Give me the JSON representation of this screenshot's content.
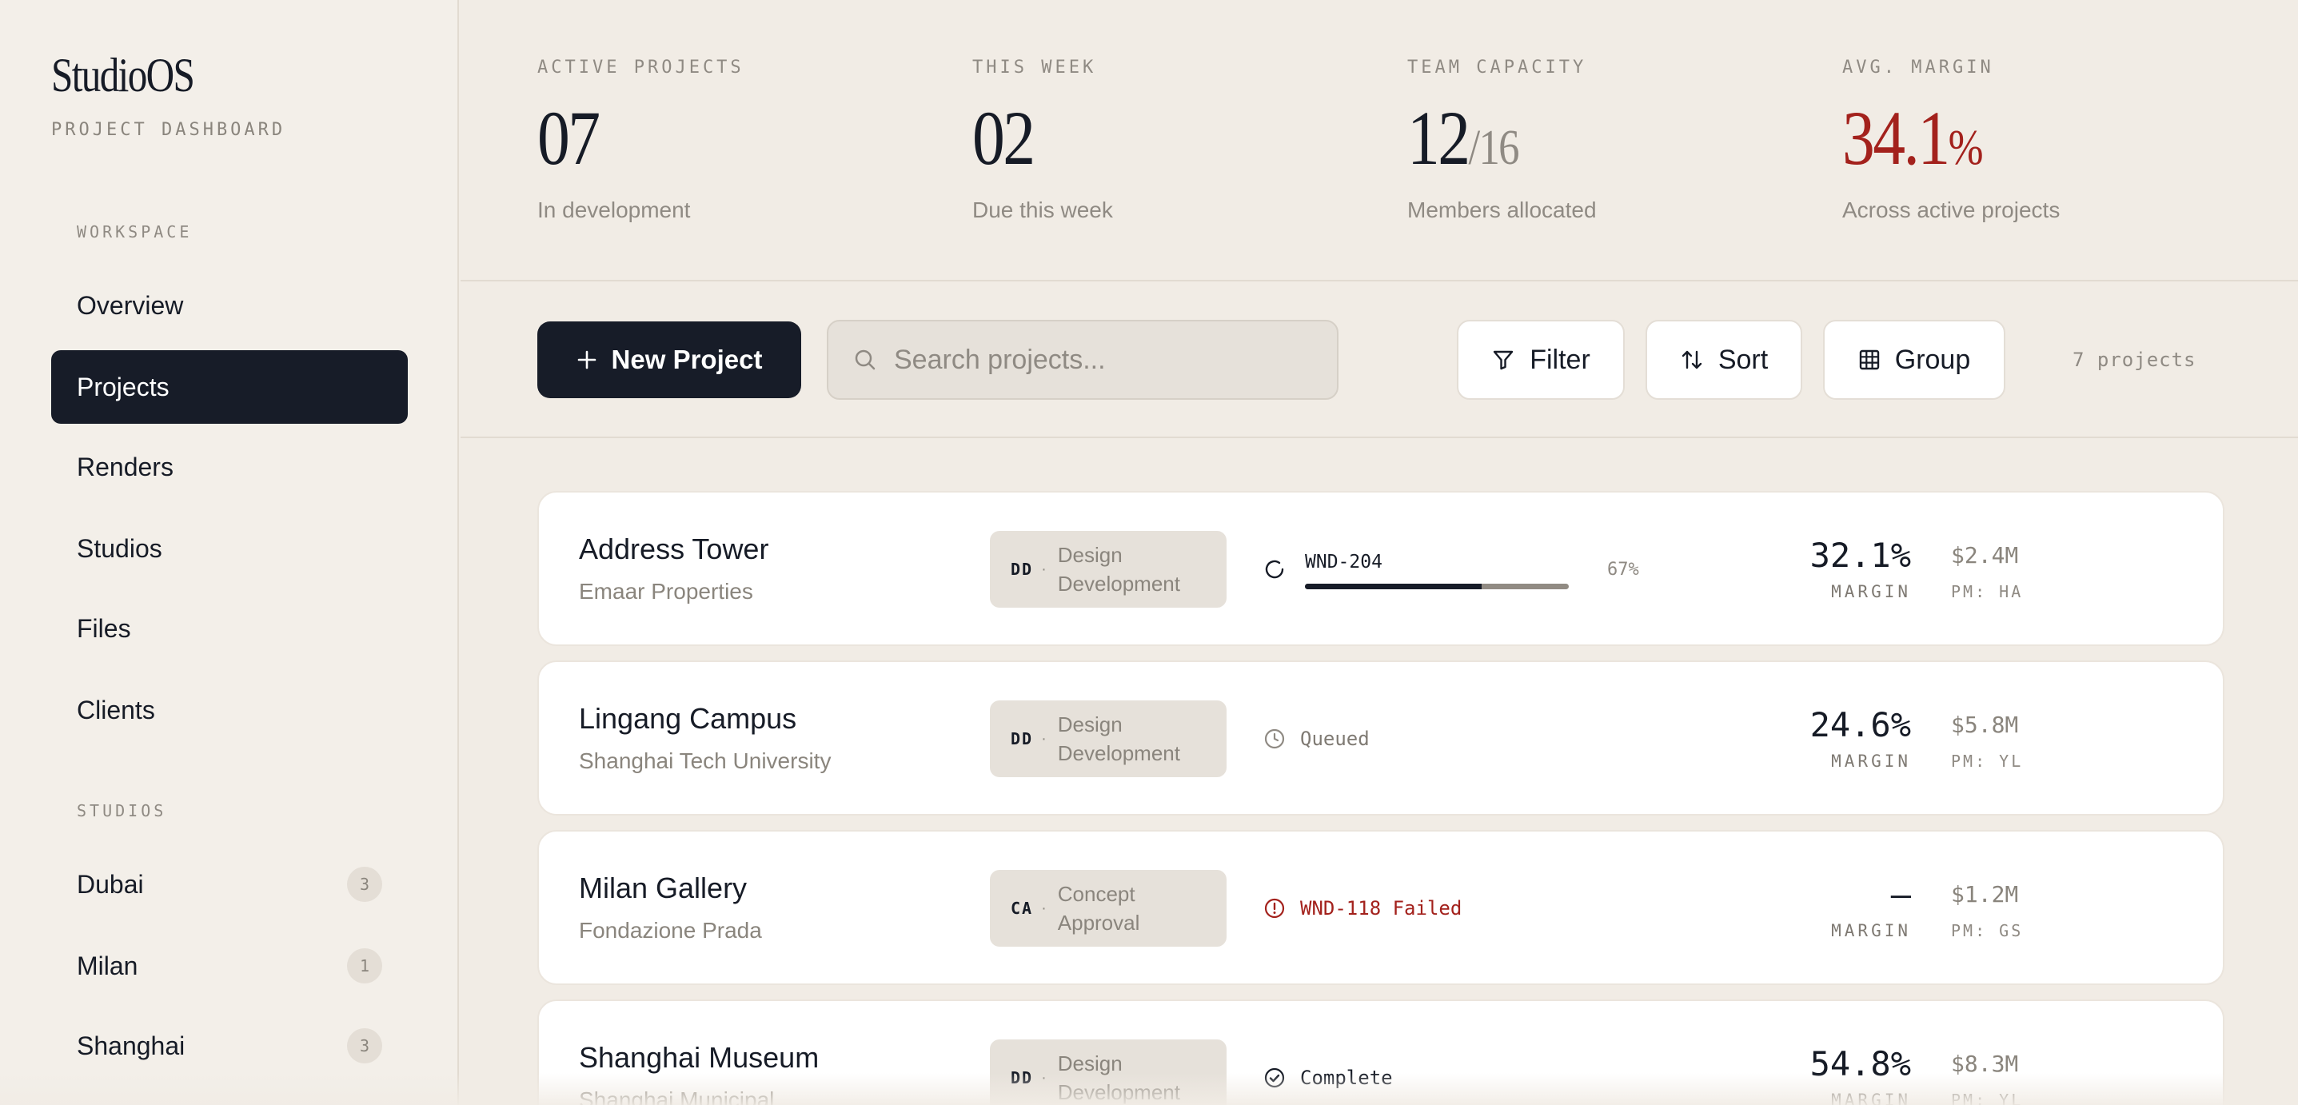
{
  "sidebar": {
    "brand": "StudioOS",
    "subtitle": "PROJECT DASHBOARD",
    "workspace_label": "WORKSPACE",
    "nav": [
      {
        "label": "Overview"
      },
      {
        "label": "Projects"
      },
      {
        "label": "Renders"
      },
      {
        "label": "Studios"
      },
      {
        "label": "Files"
      },
      {
        "label": "Clients"
      }
    ],
    "active_nav": "Projects",
    "studios_label": "STUDIOS",
    "studios": [
      {
        "name": "Dubai",
        "count": "3"
      },
      {
        "name": "Milan",
        "count": "1"
      },
      {
        "name": "Shanghai",
        "count": "3"
      }
    ]
  },
  "stats": [
    {
      "label": "ACTIVE PROJECTS",
      "value": "07",
      "caption": "In development"
    },
    {
      "label": "THIS WEEK",
      "value": "02",
      "caption": "Due this week"
    },
    {
      "label": "TEAM CAPACITY",
      "value": "12",
      "value_suffix": "/16",
      "caption": "Members allocated"
    },
    {
      "label": "AVG. MARGIN",
      "value": "34.1",
      "value_suffix": "%",
      "caption": "Across active projects"
    }
  ],
  "toolbar": {
    "new_project": "New Project",
    "search_placeholder": "Search projects...",
    "filter": "Filter",
    "sort": "Sort",
    "group": "Group",
    "count": "7 projects"
  },
  "projects": [
    {
      "name": "Address Tower",
      "client": "Emaar Properties",
      "phase_code": "DD",
      "phase_name": "Design Development",
      "status": "running",
      "job_id": "WND-204",
      "progress_text": "67%",
      "progress": 0.67,
      "margin": "32.1%",
      "margin_label": "MARGIN",
      "budget": "$2.4M",
      "pm": "PM: HA"
    },
    {
      "name": "Lingang Campus",
      "client": "Shanghai Tech University",
      "phase_code": "DD",
      "phase_name": "Design Development",
      "status": "queued",
      "status_text": "Queued",
      "margin": "24.6%",
      "margin_label": "MARGIN",
      "budget": "$5.8M",
      "pm": "PM: YL"
    },
    {
      "name": "Milan Gallery",
      "client": "Fondazione Prada",
      "phase_code": "CA",
      "phase_name": "Concept Approval",
      "status": "failed",
      "status_text": "WND-118 Failed",
      "margin": "—",
      "margin_label": "MARGIN",
      "budget": "$1.2M",
      "pm": "PM: GS"
    },
    {
      "name": "Shanghai Museum",
      "client": "Shanghai Municipal",
      "phase_code": "DD",
      "phase_name": "Design Development",
      "status": "complete",
      "status_text": "Complete",
      "margin": "54.8%",
      "margin_label": "MARGIN",
      "budget": "$8.3M",
      "pm": "PM: YL"
    }
  ],
  "colors": {
    "accent_dark": "#171c28",
    "background": "#f1ece5",
    "error": "#a3211c",
    "muted": "#8f8a83"
  }
}
